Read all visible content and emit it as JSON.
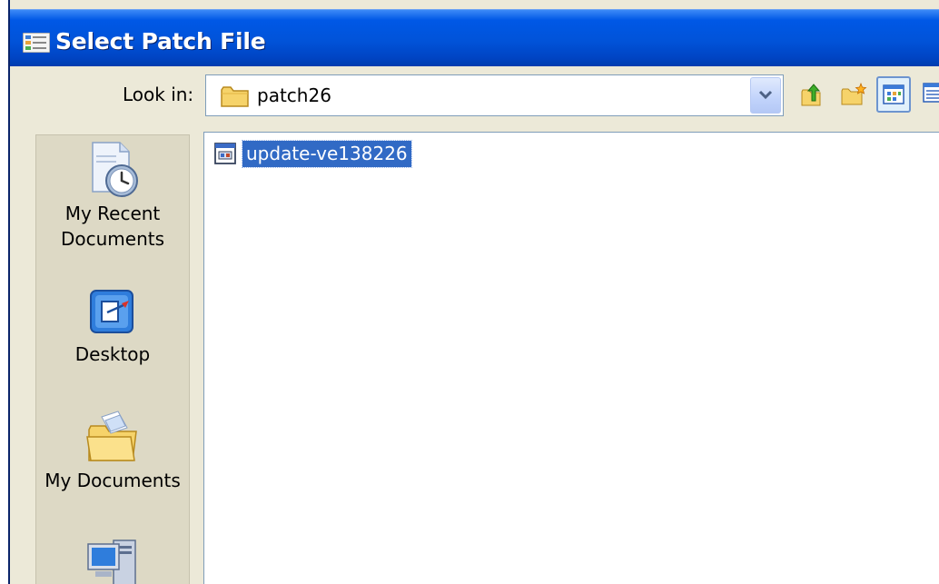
{
  "dialog": {
    "title": "Select Patch File"
  },
  "lookin": {
    "label": "Look in:",
    "value": "patch26",
    "folder_icon": "folder-icon"
  },
  "toolbar": {
    "icons": [
      "up-one-level-icon",
      "create-new-folder-icon",
      "view-menu-icon",
      "list-view-icon"
    ]
  },
  "places": [
    {
      "label_line1": "My Recent",
      "label_line2": "Documents",
      "icon": "recent-documents-icon"
    },
    {
      "label_line1": "Desktop",
      "label_line2": "",
      "icon": "desktop-icon"
    },
    {
      "label_line1": "My Documents",
      "label_line2": "",
      "icon": "my-documents-icon"
    },
    {
      "label_line1": "",
      "label_line2": "",
      "icon": "my-computer-icon"
    }
  ],
  "files": [
    {
      "name": "update-ve138226",
      "icon": "patch-file-icon",
      "selected": true
    }
  ],
  "colors": {
    "titlebar": "#0058e6",
    "selection": "#316ac5",
    "dialog_bg": "#ece9d8"
  }
}
